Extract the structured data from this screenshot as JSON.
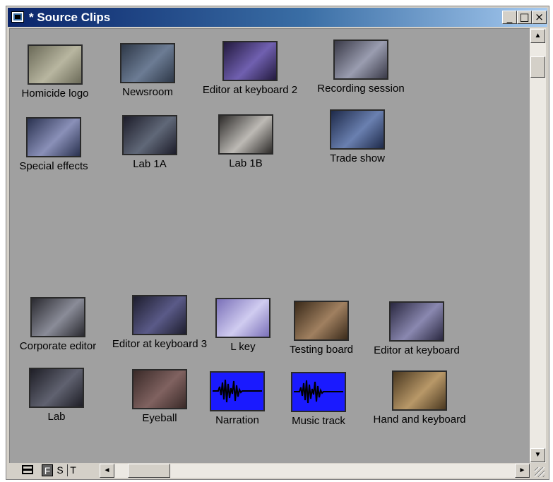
{
  "window": {
    "title": "* Source Clips",
    "buttons": {
      "minimize": "_",
      "maximize": "□",
      "close": "×"
    }
  },
  "clips": [
    {
      "label": "Homicide logo",
      "kind": "video",
      "colors": [
        "#6b6a58",
        "#b8b6a0"
      ]
    },
    {
      "label": "Newsroom",
      "kind": "video",
      "colors": [
        "#2e3848",
        "#6c7c94"
      ]
    },
    {
      "label": "Editor at keyboard 2",
      "kind": "video",
      "colors": [
        "#231a3e",
        "#7060b0"
      ]
    },
    {
      "label": "Recording session",
      "kind": "video",
      "colors": [
        "#3a3a48",
        "#9a9db0"
      ]
    },
    {
      "label": "Special effects",
      "kind": "video",
      "colors": [
        "#2a3250",
        "#8a90b8"
      ]
    },
    {
      "label": "Lab 1A",
      "kind": "video",
      "colors": [
        "#1d1d2a",
        "#606878"
      ]
    },
    {
      "label": "Lab 1B",
      "kind": "video",
      "colors": [
        "#2e2c2a",
        "#bdbab5"
      ]
    },
    {
      "label": "Trade show",
      "kind": "video",
      "colors": [
        "#1e2a4a",
        "#6a80b0"
      ]
    },
    {
      "label": "Corporate editor",
      "kind": "video",
      "colors": [
        "#2a2a30",
        "#8a8c98"
      ]
    },
    {
      "label": "Editor at keyboard 3",
      "kind": "video",
      "colors": [
        "#1e1e2e",
        "#5a5a88"
      ]
    },
    {
      "label": "L key",
      "kind": "video",
      "colors": [
        "#7a70b8",
        "#d0ccf0"
      ]
    },
    {
      "label": "Testing board",
      "kind": "video",
      "colors": [
        "#3a2a1a",
        "#a08060"
      ]
    },
    {
      "label": "Editor at keyboard",
      "kind": "video",
      "colors": [
        "#2a2840",
        "#8a88b0"
      ]
    },
    {
      "label": "Lab",
      "kind": "video",
      "colors": [
        "#1e1e26",
        "#606270"
      ]
    },
    {
      "label": "Eyeball",
      "kind": "video",
      "colors": [
        "#3a2a28",
        "#806260"
      ]
    },
    {
      "label": "Narration",
      "kind": "audio",
      "colors": [
        "#1a1aff",
        "#000000"
      ]
    },
    {
      "label": "Music track",
      "kind": "audio",
      "colors": [
        "#1a1aff",
        "#000000"
      ]
    },
    {
      "label": "Hand and keyboard",
      "kind": "video",
      "colors": [
        "#4a3820",
        "#b89868"
      ]
    }
  ],
  "bottombar": {
    "modes": [
      "F",
      "S",
      "T"
    ],
    "arrows": {
      "up": "▲",
      "down": "▼",
      "left": "◄",
      "right": "►"
    }
  }
}
